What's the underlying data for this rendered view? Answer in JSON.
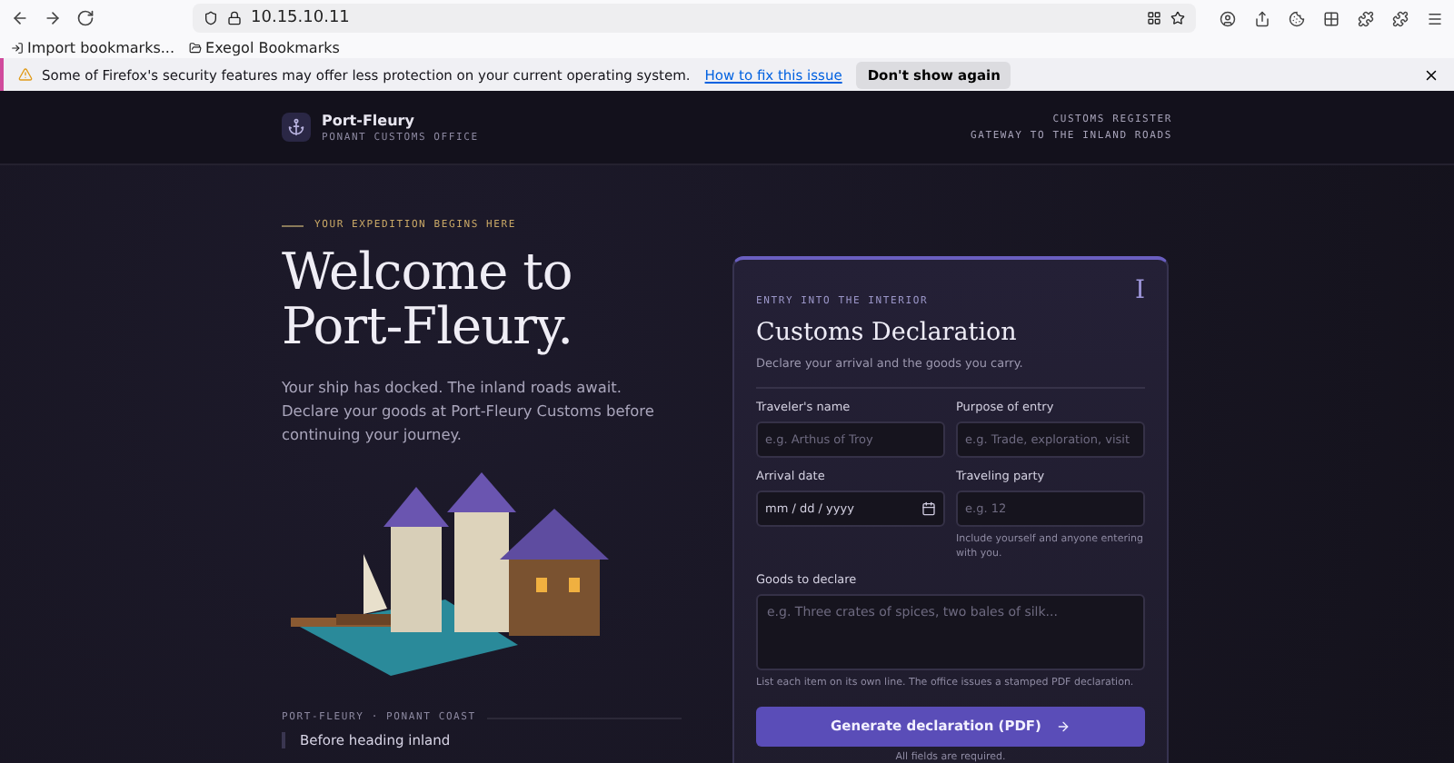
{
  "browser": {
    "url": "10.15.10.11",
    "bookmarks": [
      "Import bookmarks...",
      "Exegol Bookmarks"
    ],
    "notification": {
      "message": "Some of Firefox's security features may offer less protection on your current operating system.",
      "link": "How to fix this issue",
      "button": "Don't show again"
    }
  },
  "header": {
    "brand": "Port-Fleury",
    "subtitle": "PONANT CUSTOMS OFFICE",
    "links": [
      "CUSTOMS REGISTER",
      "GATEWAY TO THE INLAND ROADS"
    ]
  },
  "hero": {
    "eyebrow": "YOUR EXPEDITION BEGINS HERE",
    "title_lines": [
      "Welcome to",
      "Port-Fleury."
    ],
    "paragraph": "Your ship has docked. The inland roads await. Declare your goods at Port-Fleury Customs before continuing your journey.",
    "caption": "PORT-FLEURY · PONANT COAST",
    "note": "Before heading inland"
  },
  "form": {
    "eyebrow": "ENTRY INTO THE INTERIOR",
    "numeral": "I",
    "title": "Customs Declaration",
    "subtitle": "Declare your arrival and the goods you carry.",
    "fields": [
      {
        "kind": "text",
        "label": "Traveler's name",
        "placeholder": "e.g. Arthus of Troy"
      },
      {
        "kind": "text",
        "label": "Purpose of entry",
        "placeholder": "e.g. Trade, exploration, visit"
      },
      {
        "kind": "date",
        "label": "Arrival date",
        "placeholder": "mm / dd / yyyy"
      },
      {
        "kind": "text",
        "label": "Traveling party",
        "placeholder": "e.g. 12",
        "hint": "Include yourself and anyone entering with you."
      },
      {
        "kind": "textarea",
        "label": "Goods to declare",
        "placeholder": "e.g. Three crates of spices, two bales of silk...",
        "hint": "List each item on its own line. The office issues a stamped PDF declaration."
      }
    ],
    "button": "Generate declaration (PDF)",
    "footnote": "All fields are required."
  }
}
